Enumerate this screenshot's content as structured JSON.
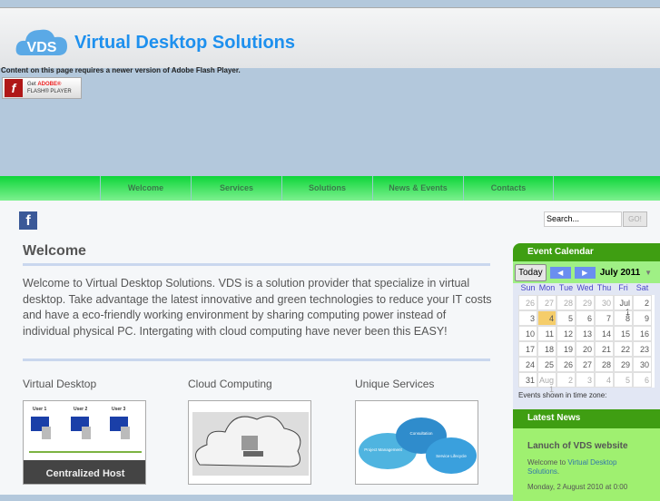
{
  "header": {
    "logo": "VDS",
    "title": "Virtual Desktop Solutions"
  },
  "flash": {
    "message": "Content on this page requires a newer version of Adobe Flash Player.",
    "button_get": "Get",
    "button_adobe": "ADOBE®",
    "button_player": "FLASH® PLAYER"
  },
  "nav": [
    {
      "label": "Welcome"
    },
    {
      "label": "Services"
    },
    {
      "label": "Solutions"
    },
    {
      "label": "News & Events"
    },
    {
      "label": "Contacts"
    }
  ],
  "search": {
    "placeholder": "Search...",
    "go": "GO!"
  },
  "main": {
    "heading": "Welcome",
    "intro": "Welcome to Virtual Desktop Solutions. VDS is a solution provider that specialize in virtual desktop. Take advantage the latest innovative and green technologies to reduce your IT costs and have a eco-friendly working environment by sharing computing power instead of individual physical PC. Intergating with cloud computing have never been this EASY!",
    "columns": [
      {
        "title": "Virtual Desktop",
        "users": [
          "User 1",
          "User 2",
          "User 3"
        ],
        "caption": "Centralized Host"
      },
      {
        "title": "Cloud Computing"
      },
      {
        "title": "Unique Services",
        "clouds": [
          "Project Management",
          "Consultation",
          "Service Lifecycle"
        ]
      }
    ]
  },
  "calendar": {
    "title": "Event Calendar",
    "today": "Today",
    "prev": "◀",
    "next": "▶",
    "month": "July 2011",
    "days": [
      "Sun",
      "Mon",
      "Tue",
      "Wed",
      "Thu",
      "Fri",
      "Sat"
    ],
    "cells": [
      "26",
      "27",
      "28",
      "29",
      "30",
      "Jul 1",
      "2",
      "3",
      "4",
      "5",
      "6",
      "7",
      "8",
      "9",
      "10",
      "11",
      "12",
      "13",
      "14",
      "15",
      "16",
      "17",
      "18",
      "19",
      "20",
      "21",
      "22",
      "23",
      "24",
      "25",
      "26",
      "27",
      "28",
      "29",
      "30",
      "31",
      "Aug 1",
      "2",
      "3",
      "4",
      "5",
      "6"
    ],
    "today_index": 8,
    "timezone": "Events shown in time zone:"
  },
  "news": {
    "title": "Latest News",
    "item_title": "Lanuch of VDS website",
    "item_prefix": "Welcome to ",
    "item_link": "Virtual Desktop Solutions",
    "item_suffix": ".",
    "item_date": "Monday, 2 August 2010 at 0:00"
  },
  "colors": {
    "nav": "#0ed53a",
    "sidebar_header": "#3f9e12",
    "title": "#1e90ee"
  }
}
